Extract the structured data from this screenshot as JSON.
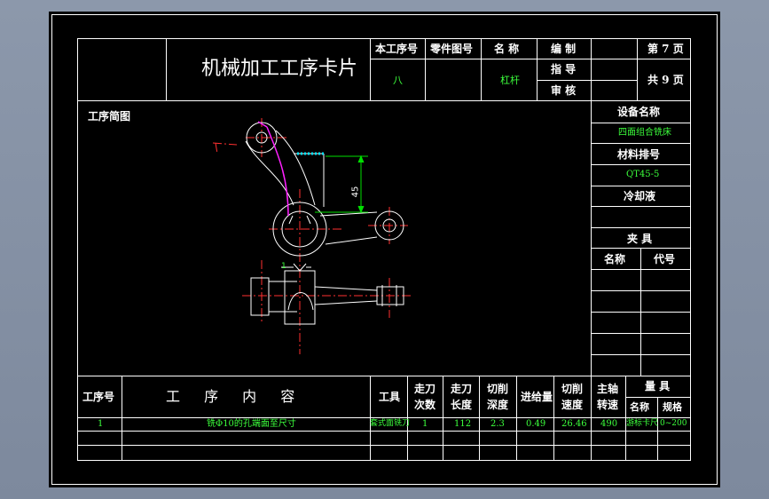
{
  "header": {
    "title": "机械加工工序卡片",
    "labels": {
      "proc_no": "本工序号",
      "part_no": "零件图号",
      "name": "名 称",
      "compile": "编 制",
      "guide": "指 导",
      "review": "审 核",
      "page": "第 7 页",
      "total": "共 9 页"
    },
    "values": {
      "proc_no": "八",
      "name": "杠杆"
    }
  },
  "sketch": {
    "label": "工序简图",
    "dimension": "45",
    "marker": "1"
  },
  "side": {
    "equipment_label": "设备名称",
    "equipment_value": "四面组合铣床",
    "material_label": "材料排号",
    "material_value": "QT45-5",
    "coolant_label": "冷却液",
    "fixture_label": "夹 具",
    "fixture_name": "名称",
    "fixture_code": "代号"
  },
  "table": {
    "headers": {
      "step_no": "工序号",
      "content": "工 序 内 容",
      "tool": "工具",
      "passes": [
        "走刀",
        "次数"
      ],
      "length": [
        "走刀",
        "长度"
      ],
      "depth": [
        "切削",
        "深度"
      ],
      "feed": "进给量",
      "speed": [
        "切削",
        "速度"
      ],
      "spindle": [
        "主轴",
        "转速"
      ],
      "gauge": "量 具",
      "gauge_name": "名称",
      "gauge_spec": "规格"
    },
    "row": {
      "step_no": "1",
      "content": "铣Φ10的孔端面至尺寸",
      "tool": "套式面铣刀",
      "passes": "1",
      "length": "112",
      "depth": "2.3",
      "feed": "0.49",
      "speed": "26.46",
      "spindle": "490",
      "gauge_name": "游标卡尺",
      "gauge_spec": "0~200"
    }
  },
  "colors": {
    "frame": "#ffffff",
    "value_text": "#3cff3c",
    "center_line": "#ff3030",
    "dimension": "#00e000",
    "hatch": "#00e5ff",
    "arc": "#ff20ff"
  }
}
